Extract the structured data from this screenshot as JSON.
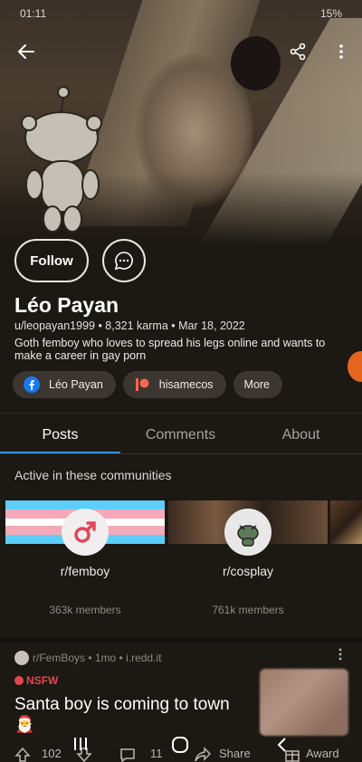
{
  "status": {
    "time": "01:11",
    "battery": "15%"
  },
  "profile": {
    "name": "Léo Payan",
    "meta": "u/leopayan1999 • 8,321 karma • Mar 18, 2022",
    "bio": "Goth femboy who loves to spread his legs online and wants to make a career in gay porn",
    "follow_label": "Follow",
    "links": [
      {
        "label": "Léo Payan",
        "icon": "facebook-icon"
      },
      {
        "label": "hisamecos",
        "icon": "patreon-icon"
      },
      {
        "label": "More",
        "icon": ""
      }
    ]
  },
  "tabs": [
    {
      "label": "Posts",
      "active": true
    },
    {
      "label": "Comments",
      "active": false
    },
    {
      "label": "About",
      "active": false
    }
  ],
  "communities": {
    "title": "Active in these communities",
    "items": [
      {
        "name": "r/femboy",
        "members": "363k members"
      },
      {
        "name": "r/cosplay",
        "members": "761k members"
      }
    ]
  },
  "post": {
    "header": "r/FemBoys • 1mo • i.redd.it",
    "nsfw": "NSFW",
    "title": "Santa boy is coming to town",
    "emoji": "🎅",
    "votes": "102",
    "comments": "11",
    "share": "Share",
    "award": "Award"
  },
  "colors": {
    "accent": "#3a8ee0",
    "nsfw": "#e64550",
    "background": "#1c1813"
  }
}
